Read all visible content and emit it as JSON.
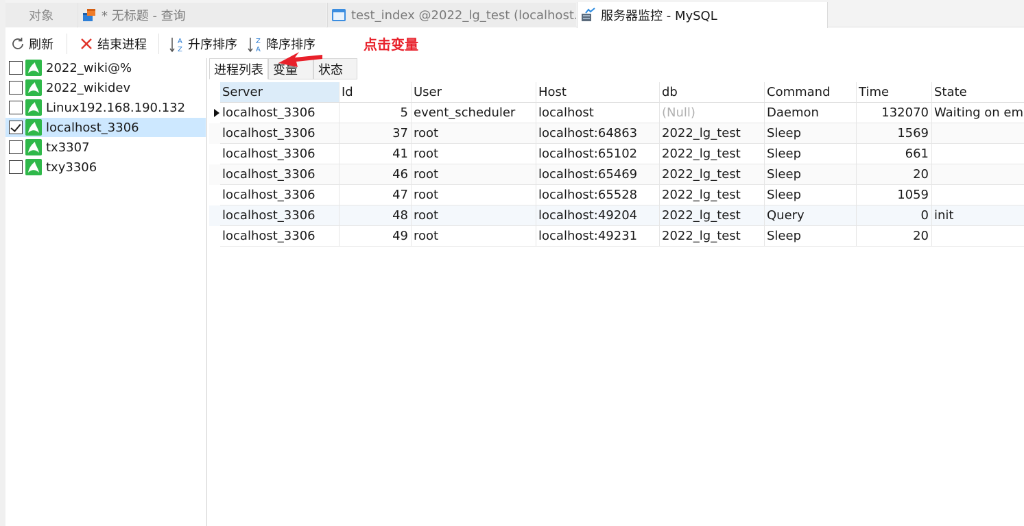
{
  "tabs": [
    {
      "label": "对象"
    },
    {
      "label": "* 无标题 - 查询"
    },
    {
      "label": "test_index @2022_lg_test (localhost..."
    },
    {
      "label": "服务器监控 - MySQL"
    }
  ],
  "toolbar": {
    "refresh": "刷新",
    "kill": "结束进程",
    "sort_asc": "升序排序",
    "sort_desc": "降序排序"
  },
  "annotation": "点击变量",
  "servers": [
    {
      "name": "2022_wiki@%",
      "checked": false
    },
    {
      "name": "2022_wikidev",
      "checked": false
    },
    {
      "name": "Linux192.168.190.132",
      "checked": false
    },
    {
      "name": "localhost_3306",
      "checked": true
    },
    {
      "name": "tx3307",
      "checked": false
    },
    {
      "name": "txy3306",
      "checked": false
    }
  ],
  "subtabs": [
    "进程列表",
    "变量",
    "状态"
  ],
  "grid": {
    "columns": [
      "Server",
      "Id",
      "User",
      "Host",
      "db",
      "Command",
      "Time",
      "State"
    ],
    "rows": [
      [
        "localhost_3306",
        "5",
        "event_scheduler",
        "localhost",
        "(Null)",
        "Daemon",
        "132070",
        "Waiting on emp"
      ],
      [
        "localhost_3306",
        "37",
        "root",
        "localhost:64863",
        "2022_lg_test",
        "Sleep",
        "1569",
        ""
      ],
      [
        "localhost_3306",
        "41",
        "root",
        "localhost:65102",
        "2022_lg_test",
        "Sleep",
        "661",
        ""
      ],
      [
        "localhost_3306",
        "46",
        "root",
        "localhost:65469",
        "2022_lg_test",
        "Sleep",
        "20",
        ""
      ],
      [
        "localhost_3306",
        "47",
        "root",
        "localhost:65528",
        "2022_lg_test",
        "Sleep",
        "1059",
        ""
      ],
      [
        "localhost_3306",
        "48",
        "root",
        "localhost:49204",
        "2022_lg_test",
        "Query",
        "0",
        "init"
      ],
      [
        "localhost_3306",
        "49",
        "root",
        "localhost:49231",
        "2022_lg_test",
        "Sleep",
        "20",
        ""
      ]
    ]
  },
  "colors": {
    "annotation": "#e8202a",
    "selected_row": "#cde8ff",
    "mysql_icon": "#2fb84a"
  }
}
